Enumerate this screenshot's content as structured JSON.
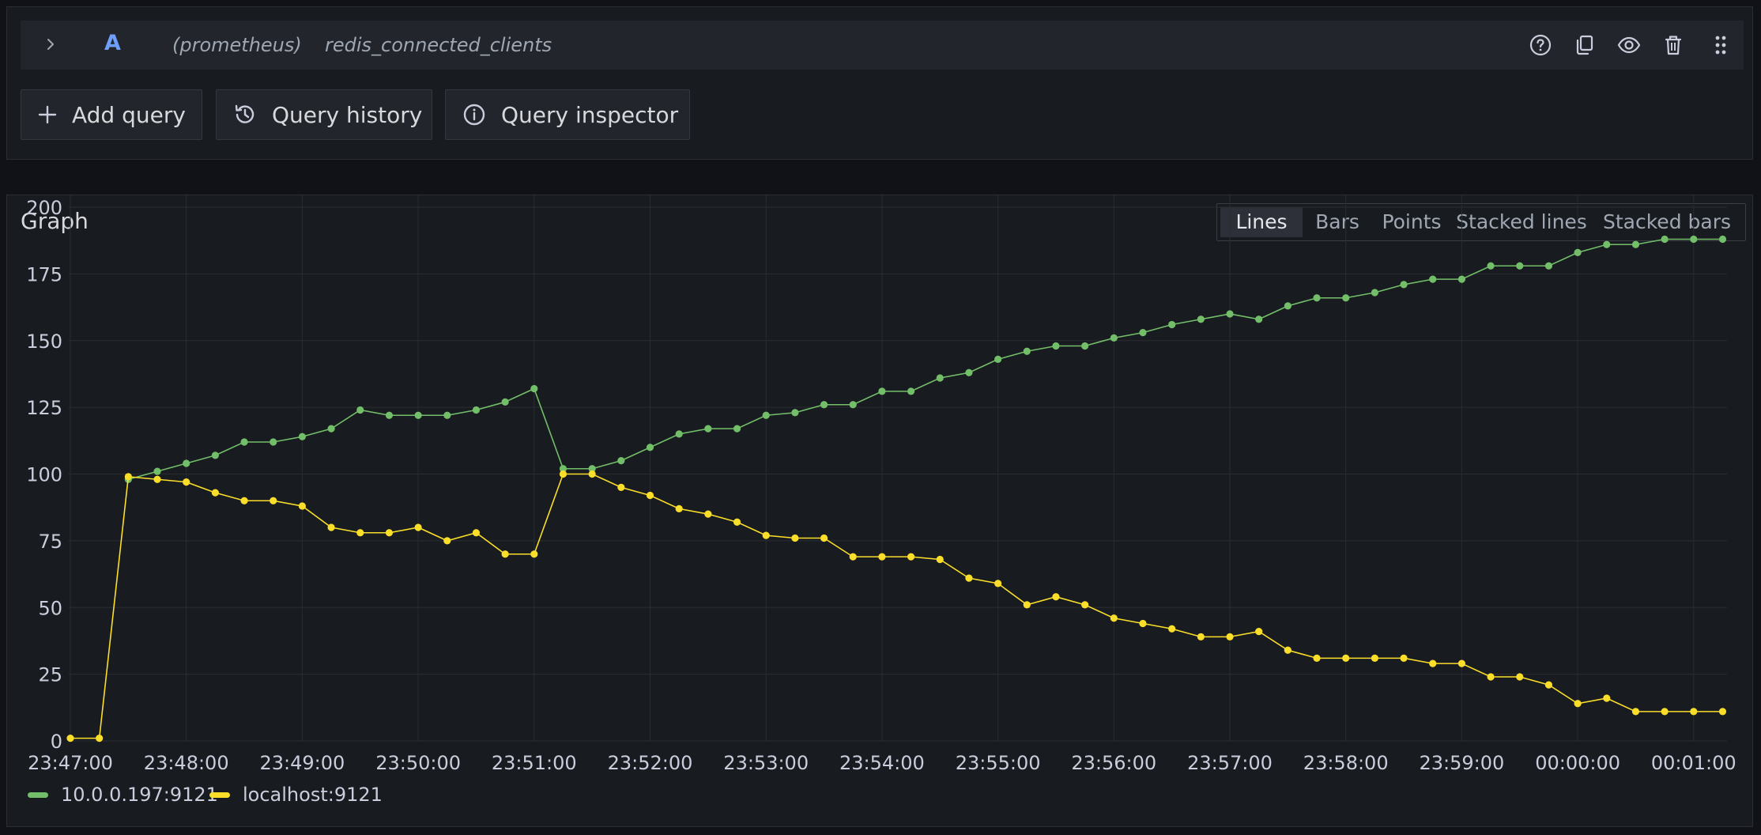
{
  "query": {
    "ref_id": "A",
    "datasource": "(prometheus)",
    "expression": "redis_connected_clients",
    "icons": [
      "help-icon",
      "duplicate-icon",
      "eye-icon",
      "trash-icon",
      "drag-handle-icon"
    ]
  },
  "buttons": {
    "add_query": "Add query",
    "query_history": "Query history",
    "query_inspector": "Query inspector"
  },
  "graph": {
    "title": "Graph",
    "view_options": [
      "Lines",
      "Bars",
      "Points",
      "Stacked lines",
      "Stacked bars"
    ],
    "active_view": "Lines"
  },
  "chart_data": {
    "type": "line",
    "x_tick_labels": [
      "23:47:00",
      "23:48:00",
      "23:49:00",
      "23:50:00",
      "23:51:00",
      "23:52:00",
      "23:53:00",
      "23:54:00",
      "23:55:00",
      "23:56:00",
      "23:57:00",
      "23:58:00",
      "23:59:00",
      "00:00:00",
      "00:01:00"
    ],
    "y_ticks": [
      0,
      25,
      50,
      75,
      100,
      125,
      150,
      175,
      200
    ],
    "ylim": [
      0,
      200
    ],
    "x_start": "23:47:00",
    "x_step_seconds": 15,
    "grid": true,
    "legend_position": "bottom-left",
    "series": [
      {
        "name": "10.0.0.197:9121",
        "color": "#73bf69",
        "values": [
          null,
          null,
          98,
          101,
          104,
          107,
          112,
          112,
          114,
          117,
          124,
          122,
          122,
          122,
          124,
          127,
          132,
          102,
          102,
          105,
          110,
          115,
          117,
          117,
          122,
          123,
          126,
          126,
          131,
          131,
          136,
          138,
          143,
          146,
          148,
          148,
          151,
          153,
          156,
          158,
          160,
          158,
          163,
          166,
          166,
          168,
          171,
          173,
          173,
          178,
          178,
          178,
          183,
          186,
          186,
          188,
          188,
          188
        ]
      },
      {
        "name": "localhost:9121",
        "color": "#fade2a",
        "values": [
          1,
          1,
          99,
          98,
          97,
          93,
          90,
          90,
          88,
          80,
          78,
          78,
          80,
          75,
          78,
          70,
          70,
          100,
          100,
          95,
          92,
          87,
          85,
          82,
          77,
          76,
          76,
          69,
          69,
          69,
          68,
          61,
          59,
          51,
          54,
          51,
          46,
          44,
          42,
          39,
          39,
          41,
          34,
          31,
          31,
          31,
          31,
          29,
          29,
          24,
          24,
          21,
          14,
          16,
          11,
          11,
          11,
          11
        ]
      }
    ]
  }
}
